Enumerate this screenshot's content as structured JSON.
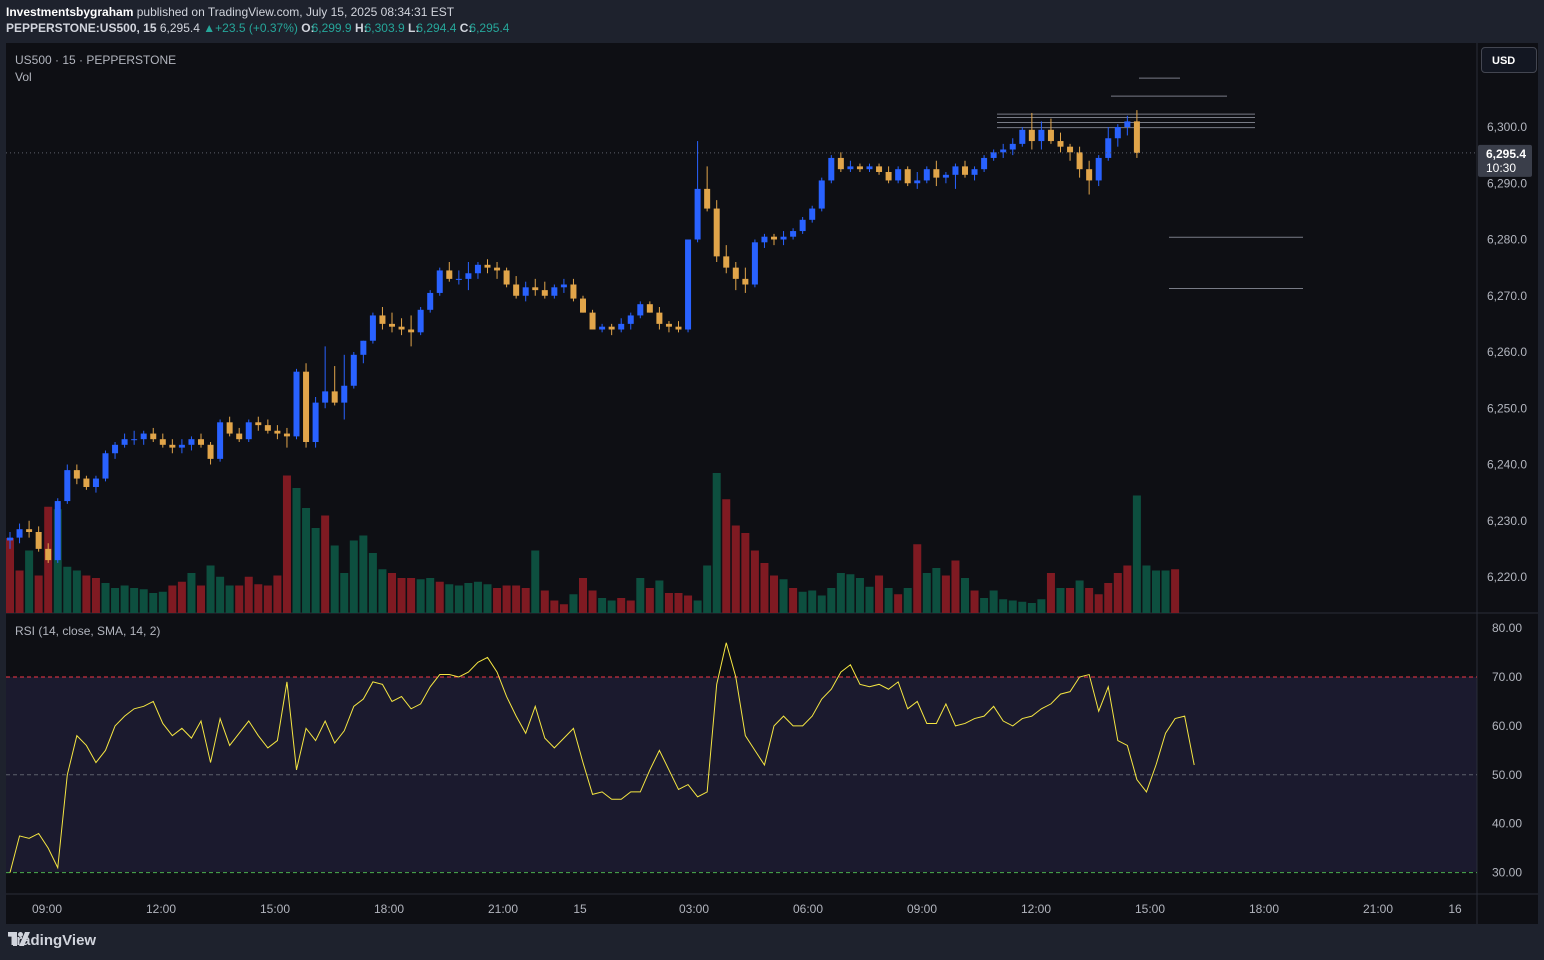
{
  "header": {
    "author": "Investmentsbygraham",
    "published": " published on TradingView.com, July 15, 2025 08:34:31 EST",
    "symbol": "PEPPERSTONE:US500, 15",
    "last": "6,295.4",
    "change": "+23.5 (+0.37%)",
    "o_label": "O:",
    "o": "6,299.9",
    "h_label": "H:",
    "h": "6,303.9",
    "l_label": "L:",
    "l": "6,294.4",
    "c_label": "C:",
    "c": "6,295.4",
    "up_arrow": "▲"
  },
  "legend": {
    "main": "US500 · 15 · PEPPERSTONE",
    "vol": "Vol",
    "rsi": "RSI (14, close, SMA, 14, 2)"
  },
  "currency": "USD",
  "price_label": {
    "price": "6,295.4",
    "countdown": "10:30"
  },
  "footer": {
    "brand": "TradingView",
    "logo": "tradingview-logo-icon"
  },
  "colors": {
    "up": "#2962ff",
    "down": "#e1a54a",
    "vol_up": "#0d4f3f",
    "vol_down": "#7f1a22",
    "rsi": "#f5e642",
    "overbought": "#f23645",
    "oversold": "#4caf50"
  },
  "chart_data": {
    "type": "candlestick",
    "symbol": "US500",
    "timeframe": "15",
    "price_axis": {
      "ticks": [
        "6,300.0",
        "6,290.0",
        "6,280.0",
        "6,270.0",
        "6,260.0",
        "6,250.0",
        "6,240.0",
        "6,230.0",
        "6,220.0"
      ],
      "range": [
        6218,
        6310
      ]
    },
    "time_axis": {
      "ticks": [
        "09:00",
        "12:00",
        "15:00",
        "18:00",
        "21:00",
        "15",
        "03:00",
        "06:00",
        "09:00",
        "12:00",
        "15:00",
        "18:00",
        "21:00",
        "16"
      ]
    },
    "candles": [
      [
        6226.5,
        6228,
        6225,
        6227
      ],
      [
        6227,
        6229.5,
        6226,
        6228.5
      ],
      [
        6228.5,
        6230,
        6227,
        6228
      ],
      [
        6228,
        6229,
        6224.5,
        6225
      ],
      [
        6225,
        6226,
        6222.5,
        6223
      ],
      [
        6223,
        6234,
        6222.5,
        6233.5
      ],
      [
        6233.5,
        6240,
        6233,
        6239
      ],
      [
        6239,
        6240,
        6236.5,
        6237.5
      ],
      [
        6237.5,
        6238,
        6235.5,
        6236
      ],
      [
        6236,
        6238,
        6235,
        6237.5
      ],
      [
        6237.5,
        6242.5,
        6237,
        6242
      ],
      [
        6242,
        6244,
        6241,
        6243.5
      ],
      [
        6243.5,
        6245.5,
        6243,
        6244.5
      ],
      [
        6244.5,
        6246,
        6243.5,
        6244.5
      ],
      [
        6244.5,
        6246,
        6243.5,
        6245.5
      ],
      [
        6245.5,
        6246.5,
        6244,
        6244.5
      ],
      [
        6244.5,
        6245.5,
        6243,
        6243.5
      ],
      [
        6243.5,
        6244.5,
        6242,
        6243
      ],
      [
        6243,
        6244.5,
        6242,
        6243.5
      ],
      [
        6243.5,
        6245,
        6242.5,
        6244.5
      ],
      [
        6244.5,
        6245.5,
        6243,
        6243.5
      ],
      [
        6243.5,
        6244,
        6240,
        6241
      ],
      [
        6241,
        6248,
        6240.5,
        6247.5
      ],
      [
        6247.5,
        6248.5,
        6245,
        6245.5
      ],
      [
        6245.5,
        6246.5,
        6244,
        6244.5
      ],
      [
        6244.5,
        6248,
        6244,
        6247.5
      ],
      [
        6247.5,
        6248.5,
        6246,
        6247
      ],
      [
        6247,
        6248,
        6245.5,
        6246
      ],
      [
        6246,
        6247,
        6244.5,
        6245.5
      ],
      [
        6245.5,
        6246.5,
        6243,
        6245
      ],
      [
        6245,
        6257,
        6244.5,
        6256.5
      ],
      [
        6256.5,
        6258,
        6243,
        6244
      ],
      [
        6244,
        6252,
        6243,
        6251
      ],
      [
        6251,
        6261,
        6250,
        6253
      ],
      [
        6253,
        6257.5,
        6250.5,
        6251
      ],
      [
        6251,
        6259.5,
        6248,
        6254
      ],
      [
        6254,
        6260,
        6253.5,
        6259.5
      ],
      [
        6259.5,
        6262,
        6258,
        6262
      ],
      [
        6262,
        6267,
        6261.5,
        6266.5
      ],
      [
        6266.5,
        6268,
        6264,
        6265
      ],
      [
        6265,
        6267,
        6263.5,
        6264.5
      ],
      [
        6264.5,
        6266,
        6263,
        6264
      ],
      [
        6264,
        6266.5,
        6261,
        6263.5
      ],
      [
        6263.5,
        6268,
        6263,
        6267.5
      ],
      [
        6267.5,
        6271,
        6267,
        6270.5
      ],
      [
        6270.5,
        6275,
        6270,
        6274.5
      ],
      [
        6274.5,
        6276,
        6272.5,
        6273
      ],
      [
        6273,
        6274.5,
        6272,
        6273
      ],
      [
        6273,
        6276,
        6271,
        6274
      ],
      [
        6274,
        6276,
        6273,
        6275.5
      ],
      [
        6275.5,
        6276.5,
        6274,
        6275
      ],
      [
        6275,
        6276,
        6273,
        6274.5
      ],
      [
        6274.5,
        6275,
        6271.5,
        6272
      ],
      [
        6272,
        6273.5,
        6269.5,
        6270
      ],
      [
        6270,
        6272.5,
        6269,
        6271.5
      ],
      [
        6271.5,
        6273,
        6270,
        6271
      ],
      [
        6271,
        6272.5,
        6269.5,
        6270
      ],
      [
        6270,
        6272,
        6269.5,
        6271.5
      ],
      [
        6271.5,
        6273,
        6270.5,
        6272
      ],
      [
        6272,
        6273,
        6269,
        6269.5
      ],
      [
        6269.5,
        6270,
        6267,
        6267
      ],
      [
        6267,
        6267.5,
        6264,
        6264
      ],
      [
        6264,
        6265,
        6263.5,
        6264.5
      ],
      [
        6264.5,
        6265,
        6263,
        6264
      ],
      [
        6264,
        6266,
        6263.5,
        6265
      ],
      [
        6265,
        6267,
        6264,
        6266.5
      ],
      [
        6266.5,
        6269,
        6266,
        6268.5
      ],
      [
        6268.5,
        6269,
        6267,
        6267
      ],
      [
        6267,
        6268,
        6264,
        6265
      ],
      [
        6265,
        6265.5,
        6263.5,
        6264.5
      ],
      [
        6264.5,
        6265.5,
        6263.5,
        6264
      ],
      [
        6264,
        6280,
        6263.5,
        6280
      ],
      [
        6280,
        6297.5,
        6279.5,
        6289
      ],
      [
        6289,
        6293,
        6285,
        6285.5
      ],
      [
        6285.5,
        6287,
        6276,
        6277
      ],
      [
        6277,
        6279,
        6274,
        6275
      ],
      [
        6275,
        6276,
        6271,
        6273
      ],
      [
        6273,
        6275,
        6270.5,
        6272
      ],
      [
        6272,
        6280,
        6271.5,
        6279.5
      ],
      [
        6279.5,
        6281,
        6278.5,
        6280.5
      ],
      [
        6280.5,
        6281,
        6279,
        6280
      ],
      [
        6280,
        6281.5,
        6279,
        6280.5
      ],
      [
        6280.5,
        6282,
        6280,
        6281.5
      ],
      [
        6281.5,
        6284,
        6281,
        6283.5
      ],
      [
        6283.5,
        6286,
        6283,
        6285.5
      ],
      [
        6285.5,
        6291,
        6285,
        6290.5
      ],
      [
        6290.5,
        6295,
        6290,
        6294.5
      ],
      [
        6294.5,
        6295.5,
        6292,
        6292.5
      ],
      [
        6292.5,
        6294,
        6292,
        6293
      ],
      [
        6293,
        6293.5,
        6292,
        6292.5
      ],
      [
        6292.5,
        6293.5,
        6292,
        6293
      ],
      [
        6293,
        6293.5,
        6291.5,
        6292
      ],
      [
        6292,
        6293,
        6290,
        6290.5
      ],
      [
        6290.5,
        6293,
        6290,
        6292.5
      ],
      [
        6292.5,
        6293,
        6289.5,
        6290
      ],
      [
        6290,
        6292,
        6289,
        6290.5
      ],
      [
        6290.5,
        6293,
        6290,
        6292.5
      ],
      [
        6292.5,
        6294,
        6289.5,
        6291
      ],
      [
        6291,
        6292,
        6290,
        6291.5
      ],
      [
        6291.5,
        6293.5,
        6289,
        6293
      ],
      [
        6293,
        6294,
        6291,
        6291.5
      ],
      [
        6291.5,
        6293,
        6290.5,
        6292.5
      ],
      [
        6292.5,
        6295,
        6292,
        6294.5
      ],
      [
        6294.5,
        6296,
        6294,
        6295.5
      ],
      [
        6295.5,
        6297,
        6294.5,
        6296
      ],
      [
        6296,
        6298,
        6295,
        6297
      ],
      [
        6297,
        6300,
        6296.5,
        6299.5
      ],
      [
        6299.5,
        6302.5,
        6296,
        6297.5
      ],
      [
        6297.5,
        6301,
        6296,
        6299.5
      ],
      [
        6299.5,
        6301.5,
        6297,
        6297.5
      ],
      [
        6297.5,
        6299,
        6295.5,
        6296.5
      ],
      [
        6296.5,
        6297,
        6294,
        6295.5
      ],
      [
        6295.5,
        6296.5,
        6291,
        6292.5
      ],
      [
        6292.5,
        6294,
        6288,
        6290.5
      ],
      [
        6290.5,
        6295,
        6289.5,
        6294.5
      ],
      [
        6294.5,
        6300,
        6294,
        6298
      ],
      [
        6298,
        6300.5,
        6296.5,
        6300
      ],
      [
        6300,
        6302,
        6298.5,
        6301
      ],
      [
        6301,
        6303,
        6294.5,
        6295.4
      ]
    ],
    "volume": [
      [
        60,
        1
      ],
      [
        34,
        1
      ],
      [
        50,
        0
      ],
      [
        30,
        1
      ],
      [
        85,
        1
      ],
      [
        83,
        0
      ],
      [
        37,
        0
      ],
      [
        34,
        0
      ],
      [
        30,
        1
      ],
      [
        28,
        1
      ],
      [
        24,
        0
      ],
      [
        20,
        0
      ],
      [
        22,
        0
      ],
      [
        20,
        0
      ],
      [
        19,
        0
      ],
      [
        16,
        0
      ],
      [
        17,
        0
      ],
      [
        22,
        1
      ],
      [
        25,
        1
      ],
      [
        32,
        0
      ],
      [
        22,
        1
      ],
      [
        38,
        0
      ],
      [
        29,
        0
      ],
      [
        22,
        0
      ],
      [
        22,
        1
      ],
      [
        29,
        1
      ],
      [
        23,
        1
      ],
      [
        22,
        1
      ],
      [
        30,
        1
      ],
      [
        110,
        1
      ],
      [
        100,
        0
      ],
      [
        84,
        0
      ],
      [
        68,
        0
      ],
      [
        78,
        1
      ],
      [
        54,
        0
      ],
      [
        32,
        0
      ],
      [
        58,
        0
      ],
      [
        62,
        0
      ],
      [
        48,
        0
      ],
      [
        35,
        0
      ],
      [
        32,
        1
      ],
      [
        28,
        1
      ],
      [
        28,
        1
      ],
      [
        27,
        0
      ],
      [
        28,
        0
      ],
      [
        25,
        1
      ],
      [
        23,
        0
      ],
      [
        22,
        0
      ],
      [
        24,
        0
      ],
      [
        25,
        0
      ],
      [
        23,
        0
      ],
      [
        20,
        1
      ],
      [
        22,
        1
      ],
      [
        22,
        1
      ],
      [
        20,
        1
      ],
      [
        50,
        0
      ],
      [
        18,
        1
      ],
      [
        10,
        1
      ],
      [
        7,
        1
      ],
      [
        15,
        0
      ],
      [
        28,
        1
      ],
      [
        18,
        1
      ],
      [
        12,
        0
      ],
      [
        10,
        0
      ],
      [
        12,
        1
      ],
      [
        10,
        1
      ],
      [
        28,
        0
      ],
      [
        20,
        1
      ],
      [
        26,
        0
      ],
      [
        16,
        1
      ],
      [
        16,
        1
      ],
      [
        14,
        1
      ],
      [
        10,
        0
      ],
      [
        38,
        0
      ],
      [
        112,
        0
      ],
      [
        91,
        1
      ],
      [
        70,
        1
      ],
      [
        64,
        1
      ],
      [
        50,
        1
      ],
      [
        40,
        1
      ],
      [
        30,
        1
      ],
      [
        27,
        0
      ],
      [
        20,
        1
      ],
      [
        17,
        0
      ],
      [
        18,
        0
      ],
      [
        14,
        0
      ],
      [
        20,
        0
      ],
      [
        32,
        0
      ],
      [
        31,
        0
      ],
      [
        28,
        0
      ],
      [
        21,
        0
      ],
      [
        30,
        1
      ],
      [
        20,
        0
      ],
      [
        15,
        1
      ],
      [
        20,
        0
      ],
      [
        55,
        1
      ],
      [
        32,
        0
      ],
      [
        36,
        0
      ],
      [
        30,
        1
      ],
      [
        42,
        1
      ],
      [
        28,
        0
      ],
      [
        18,
        1
      ],
      [
        12,
        0
      ],
      [
        18,
        0
      ],
      [
        11,
        0
      ],
      [
        10,
        0
      ],
      [
        9,
        0
      ],
      [
        8,
        0
      ],
      [
        11,
        0
      ],
      [
        32,
        1
      ],
      [
        20,
        0
      ],
      [
        20,
        1
      ],
      [
        26,
        0
      ],
      [
        20,
        1
      ],
      [
        15,
        1
      ],
      [
        24,
        1
      ],
      [
        32,
        1
      ],
      [
        38,
        1
      ],
      [
        94,
        0
      ],
      [
        38,
        0
      ],
      [
        34,
        0
      ],
      [
        34,
        0
      ],
      [
        35,
        1
      ]
    ],
    "horizontal_levels": [
      6308.7,
      6305.5,
      6302.3,
      6301.7,
      6300.8,
      6299.9,
      6280.4,
      6271.3
    ],
    "rsi": {
      "upper": 70,
      "middle": 50,
      "lower": 30,
      "ticks": [
        "80.00",
        "70.00",
        "60.00",
        "50.00",
        "40.00",
        "30.00"
      ],
      "values": [
        30,
        37.5,
        37,
        38,
        35,
        31,
        50,
        58,
        56,
        52.5,
        55,
        60,
        62,
        63.5,
        64,
        65,
        60.5,
        58,
        59.5,
        57.5,
        61,
        52.5,
        61.5,
        56,
        58.5,
        61,
        58,
        55.5,
        57,
        69,
        51,
        59.5,
        57,
        61,
        56.5,
        59,
        64,
        65.5,
        69,
        68.5,
        65,
        66,
        63.5,
        64.5,
        68,
        70.5,
        70.5,
        70,
        71,
        73,
        74,
        71,
        66,
        62,
        58.5,
        64,
        57.5,
        55.5,
        57.5,
        59.5,
        52.5,
        46,
        46.5,
        45,
        45,
        46.5,
        46.5,
        51,
        55,
        51,
        47,
        48,
        45.5,
        46.5,
        68.5,
        77,
        70,
        58,
        55,
        52,
        60,
        62,
        60,
        60,
        62,
        65.5,
        67.5,
        71,
        72.5,
        68.5,
        68,
        68.5,
        67.5,
        69,
        63.5,
        65,
        60.5,
        60.5,
        64.5,
        60,
        60.5,
        61.5,
        62,
        64,
        61,
        60,
        61.5,
        62,
        63.5,
        64.5,
        66.5,
        67,
        70,
        70.5,
        63,
        68,
        57,
        56,
        49,
        46.5,
        52,
        58.5,
        61.5,
        62,
        52
      ]
    }
  }
}
